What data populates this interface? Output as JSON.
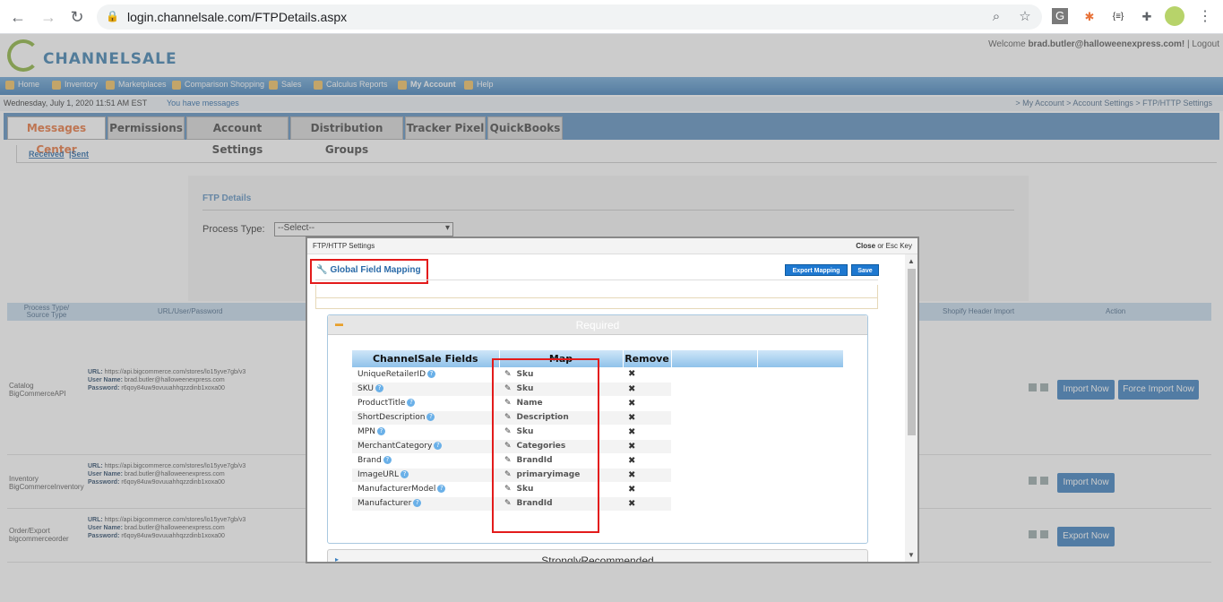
{
  "browser": {
    "url": "login.channelsale.com/FTPDetails.aspx"
  },
  "site": {
    "logo_text": "CHANNELSALE",
    "welcome_prefix": "Welcome",
    "welcome_user": "brad.butler@halloweenexpress.com!",
    "logout": "| Logout",
    "menu": [
      "Home",
      "Inventory",
      "Marketplaces",
      "Comparison Shopping",
      "Sales",
      "Calculus Reports",
      "My Account",
      "Help"
    ],
    "date": "Wednesday, July 1, 2020 11:51 AM EST",
    "messages": "You have messages",
    "breadcrumb": "> My Account > Account Settings > FTP/HTTP Settings",
    "tabs": [
      "Messages Center",
      "Permissions",
      "Account Settings",
      "Distribution Groups",
      "Tracker Pixel",
      "QuickBooks"
    ],
    "sub_received": "Received",
    "sub_sent": "|Sent"
  },
  "ftp": {
    "title": "FTP Details",
    "process_type_label": "Process Type:",
    "process_type_value": "--Select--"
  },
  "grid": {
    "headers": [
      "Process Type/ Source Type",
      "URL/User/Password",
      "Shopify Header Import",
      "Action"
    ],
    "rows": [
      {
        "type": "Catalog BigCommerceAPI",
        "url": "https://api.bigcommerce.com/stores/lo15yve7gb/v3",
        "user": "brad.butler@halloweenexpress.com",
        "password": "r6qoy84uw9ovuuahhqzzdinb1xoxa00",
        "buttons": [
          "Import Now",
          "Force Import Now"
        ]
      },
      {
        "type": "Inventory BigCommerceInventory",
        "url": "https://api.bigcommerce.com/stores/lo15yve7gb/v3",
        "user": "brad.butler@halloweenexpress.com",
        "password": "r6qoy84uw9ovuuahhqzzdinb1xoxa00",
        "buttons": [
          "Import Now"
        ]
      },
      {
        "type": "Order/Export bigcommerceorder",
        "url": "https://api.bigcommerce.com/stores/lo15yve7gb/v3",
        "user": "brad.butler@halloweenexpress.com",
        "password": "r6qoy84uw9ovuuahhqzzdinb1xoxa00",
        "buttons": [
          "Export Now"
        ]
      }
    ],
    "url_label": "URL:",
    "user_label": "User Name:",
    "pass_label": "Password:"
  },
  "modal": {
    "title": "FTP/HTTP Settings",
    "close_bold": "Close",
    "close_rest": "or Esc Key",
    "global_mapping": "Global Field Mapping",
    "export_mapping": "Export Mapping",
    "save": "Save",
    "required_label": "Required",
    "strongly_recommended_label": "StronglyRecommended",
    "table_headers": [
      "ChannelSale Fields",
      "Map",
      "Remove"
    ],
    "rows": [
      {
        "field": "UniqueRetailerID",
        "map": "Sku"
      },
      {
        "field": "SKU",
        "map": "Sku"
      },
      {
        "field": "ProductTitle",
        "map": "Name"
      },
      {
        "field": "ShortDescription",
        "map": "Description"
      },
      {
        "field": "MPN",
        "map": "Sku"
      },
      {
        "field": "MerchantCategory",
        "map": "Categories"
      },
      {
        "field": "Brand",
        "map": "BrandId"
      },
      {
        "field": "ImageURL",
        "map": "primaryimage"
      },
      {
        "field": "ManufacturerModel",
        "map": "Sku"
      },
      {
        "field": "Manufacturer",
        "map": "BrandId"
      }
    ]
  },
  "colors": {
    "highlight_red": "#e31b1b",
    "link_blue": "#2a6aa8",
    "button_blue": "#1e78d0"
  }
}
